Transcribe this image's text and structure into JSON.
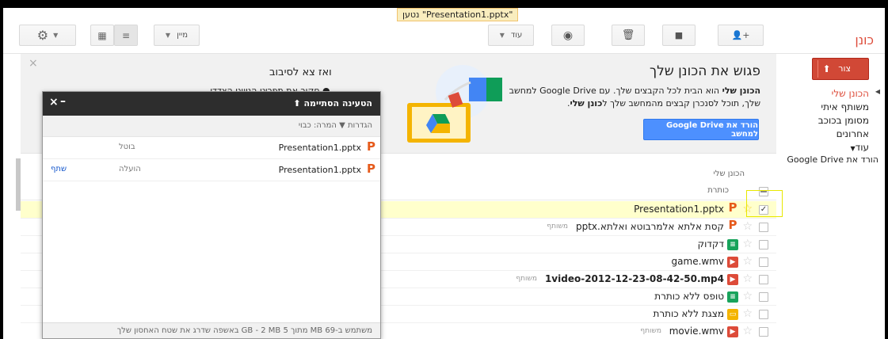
{
  "toast": "\"Presentation1.pptx\" נטען",
  "brand": "כונן",
  "toolbar": {
    "sort_label": "מיין",
    "more_label": "עוד"
  },
  "nav": {
    "create": "צור",
    "items": [
      "הכונן שלי",
      "משותף איתי",
      "מסומן בכוכב",
      "אחרונים",
      "עוד"
    ],
    "download": "הורד את Google Drive"
  },
  "welcome": {
    "title": "פגוש את הכונן שלך",
    "line1_bold": "הכונן שלי",
    "line1": " הוא הבית לכל הקבצים שלך. עם Google Drive למחשב",
    "line2_pre": "שלך, תוכל לסנכרן קבצים מהמחשב שלך ל",
    "line2_bold": "כונן שלי",
    "line2_end": ".",
    "download_btn": "הורד את Google Drive למחשב",
    "tour_title": "ואז צא לסיבוב",
    "tour_item": "חקור את תפריט הניווט הצדדי."
  },
  "list": {
    "section": "הכונן שלי",
    "column_title": "כותרת",
    "files": [
      {
        "name": "Presentation1.pptx",
        "type": "ppt",
        "shared": "",
        "bold": false,
        "selected": true
      },
      {
        "name": "קסת אלתא אלמרבוטא ואלתא.pptx",
        "type": "ppt",
        "shared": "משותף",
        "bold": false,
        "selected": false
      },
      {
        "name": "דקדוק",
        "type": "sheet",
        "shared": "",
        "bold": false,
        "selected": false
      },
      {
        "name": "game.wmv",
        "type": "video",
        "shared": "",
        "bold": false,
        "selected": false
      },
      {
        "name": "1video-2012-12-23-08-42-50.mp4",
        "type": "video",
        "shared": "משותף",
        "bold": true,
        "selected": false
      },
      {
        "name": "טופס ללא כותרת",
        "type": "sheet",
        "shared": "",
        "bold": false,
        "selected": false
      },
      {
        "name": "מצגת ללא כותרת",
        "type": "slide",
        "shared": "",
        "bold": false,
        "selected": false
      },
      {
        "name": "movie.wmv",
        "type": "video",
        "shared": "משותף",
        "bold": false,
        "selected": false
      }
    ]
  },
  "upload": {
    "title": "הטעינה הסתיימה",
    "settings": "הגדרות ▼ המרה: כבוי",
    "rows": [
      {
        "name": "Presentation1.pptx",
        "status": "בוטל",
        "action": ""
      },
      {
        "name": "Presentation1.pptx",
        "status": "הועלה",
        "action": "שתף"
      }
    ],
    "footer": "משתמש ב-69 MB מתוך 5 GB - 2 MB באשפה   שדרג את שטח האחסון שלך"
  }
}
